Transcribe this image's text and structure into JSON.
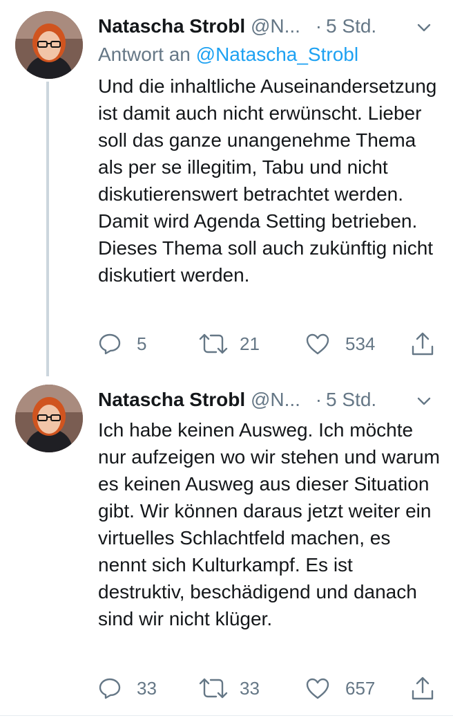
{
  "colors": {
    "text": "#14171a",
    "secondary": "#657786",
    "link": "#1da1f2",
    "thread_line": "#ccd6dd",
    "divider": "#e6ecf0"
  },
  "tweets": [
    {
      "author_name": "Natascha Strobl",
      "author_handle": "@N...",
      "separator": "·",
      "time": "5 Std.",
      "reply_prefix": "Antwort an",
      "reply_mention": "@Natascha_Strobl",
      "text": "Und die inhaltliche Auseinandersetzung ist damit auch nicht erwünscht. Lieber soll das ganze unangenehme Thema als per se illegitim, Tabu und nicht diskutierenswert betrachtet werden. Damit wird Agenda Setting betrieben. Dieses Thema soll auch zukünftig nicht diskutiert werden.",
      "replies": "5",
      "retweets": "21",
      "likes": "534"
    },
    {
      "author_name": "Natascha Strobl",
      "author_handle": "@N...",
      "separator": "·",
      "time": "5 Std.",
      "text": "Ich habe keinen Ausweg. Ich möchte nur aufzeigen wo wir stehen und warum es keinen Ausweg aus dieser Situation gibt. Wir können daraus jetzt weiter ein virtuelles Schlachtfeld machen, es nennt sich Kulturkampf. Es ist destruktiv, beschädigend und danach sind wir nicht klüger.",
      "replies": "33",
      "retweets": "33",
      "likes": "657"
    }
  ]
}
